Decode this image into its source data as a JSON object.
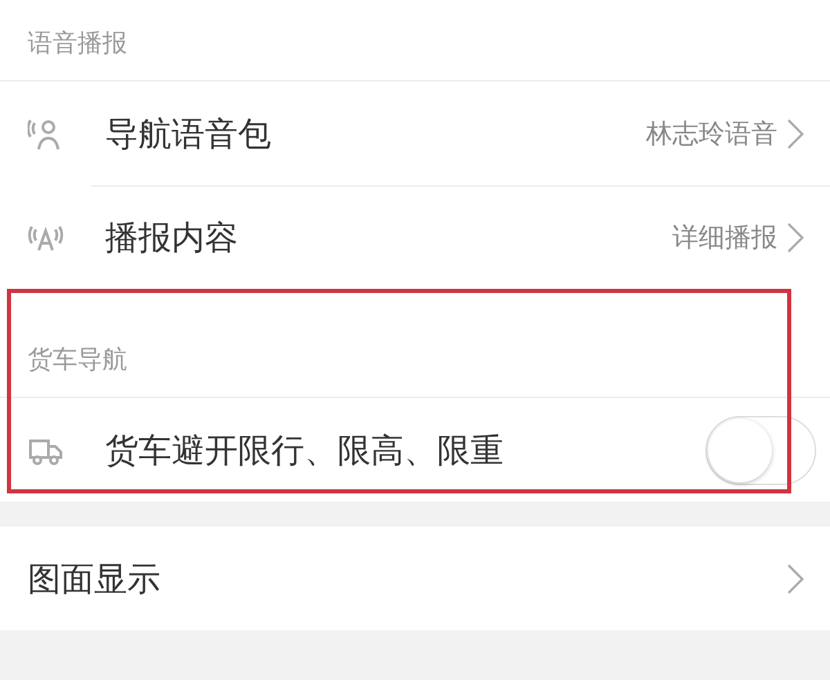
{
  "sections": [
    {
      "header": "语音播报",
      "highlighted": false,
      "rows": [
        {
          "kind": "link",
          "label": "导航语音包",
          "value": "林志玲语音"
        },
        {
          "kind": "link",
          "label": "播报内容",
          "value": "详细播报"
        }
      ]
    },
    {
      "header": "货车导航",
      "highlighted": true,
      "rows": [
        {
          "kind": "toggle",
          "label": "货车避开限行、限高、限重",
          "checked": false
        }
      ]
    },
    {
      "highlighted": false,
      "rows": [
        {
          "kind": "link",
          "label": "图面显示"
        }
      ]
    }
  ]
}
